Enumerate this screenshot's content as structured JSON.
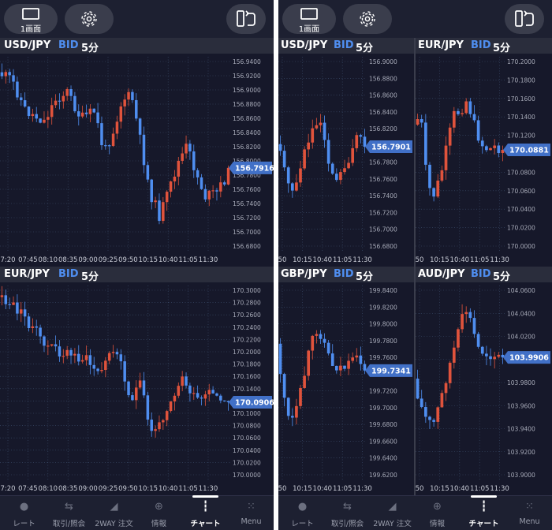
{
  "layout": {
    "single_screen_label": "1画面"
  },
  "colors": {
    "background": "#16182a",
    "grid": "#3c4f6e",
    "bear": "#4f8ef0",
    "bull": "#e0533c",
    "price_tag": "#4170c7",
    "text": "#ffffff",
    "axis_text": "#a7aab8"
  },
  "left_screen": {
    "charts": [
      {
        "id": "L_USDJPY",
        "pair": "USD/JPY",
        "side": "BID",
        "timeframe": "5分",
        "current_price": "156.7916",
        "y_labels": [
          "156.9400",
          "156.9200",
          "156.9000",
          "156.8800",
          "156.8600",
          "156.8400",
          "156.8200",
          "156.8000",
          "156.7800",
          "156.7600",
          "156.7400",
          "156.7200",
          "156.7000",
          "156.6800"
        ],
        "x_labels": [
          "7:20",
          "07:45",
          "08:10",
          "08:35",
          "09:00",
          "09:25",
          "09:50",
          "10:15",
          "10:40",
          "11:05",
          "11:30"
        ]
      },
      {
        "id": "L_EURJPY",
        "pair": "EUR/JPY",
        "side": "BID",
        "timeframe": "5分",
        "current_price": "170.0906",
        "y_labels": [
          "170.3000",
          "170.2800",
          "170.2600",
          "170.2400",
          "170.2200",
          "170.2000",
          "170.1800",
          "170.1600",
          "170.1400",
          "170.1200",
          "170.1000",
          "170.0800",
          "170.0600",
          "170.0400",
          "170.0200",
          "170.0000"
        ],
        "x_labels": [
          "7:20",
          "07:45",
          "08:10",
          "08:35",
          "09:00",
          "09:25",
          "09:50",
          "10:15",
          "10:40",
          "11:05",
          "11:30"
        ]
      }
    ]
  },
  "right_screen": {
    "charts": [
      {
        "id": "R_USDJPY",
        "pair": "USD/JPY",
        "side": "BID",
        "timeframe": "5分",
        "current_price": "156.7901",
        "y_labels": [
          "156.9000",
          "156.8800",
          "156.8600",
          "156.8400",
          "156.8200",
          "156.8000",
          "156.7800",
          "156.7600",
          "156.7400",
          "156.7200",
          "156.7000",
          "156.6800"
        ],
        "x_labels": [
          "50",
          "10:15",
          "10:40",
          "11:05",
          "11:30"
        ]
      },
      {
        "id": "R_EURJPY",
        "pair": "EUR/JPY",
        "side": "BID",
        "timeframe": "5分",
        "current_price": "170.0881",
        "y_labels": [
          "170.2000",
          "170.1800",
          "170.1600",
          "170.1400",
          "170.1200",
          "170.1000",
          "170.0800",
          "170.0600",
          "170.0400",
          "170.0200",
          "170.0000"
        ],
        "x_labels": [
          "50",
          "10:15",
          "10:40",
          "11:05",
          "11:30"
        ]
      },
      {
        "id": "R_GBPJPY",
        "pair": "GBP/JPY",
        "side": "BID",
        "timeframe": "5分",
        "current_price": "199.7341",
        "y_labels": [
          "199.8400",
          "199.8200",
          "199.8000",
          "199.7800",
          "199.7600",
          "199.7400",
          "199.7200",
          "199.7000",
          "199.6800",
          "199.6600",
          "199.6400",
          "199.6200"
        ],
        "x_labels": [
          "50",
          "10:15",
          "10:40",
          "11:05",
          "11:30"
        ]
      },
      {
        "id": "R_AUDJPY",
        "pair": "AUD/JPY",
        "side": "BID",
        "timeframe": "5分",
        "current_price": "103.9906",
        "y_labels": [
          "104.0600",
          "104.0400",
          "104.0200",
          "104.0000",
          "103.9800",
          "103.9600",
          "103.9400",
          "103.9200",
          "103.9000"
        ],
        "x_labels": [
          "50",
          "10:15",
          "10:40",
          "11:05",
          "11:30"
        ]
      }
    ]
  },
  "tabs": [
    {
      "label": "レート",
      "icon": "rate-icon",
      "active": false
    },
    {
      "label": "取引/照会",
      "icon": "trade-icon",
      "active": false
    },
    {
      "label": "2WAY 注文",
      "icon": "2way-icon",
      "active": false
    },
    {
      "label": "情報",
      "icon": "info-icon",
      "active": false
    },
    {
      "label": "チャート",
      "icon": "chart-icon",
      "active": true
    },
    {
      "label": "Menu",
      "icon": "menu-icon",
      "active": false
    }
  ]
}
